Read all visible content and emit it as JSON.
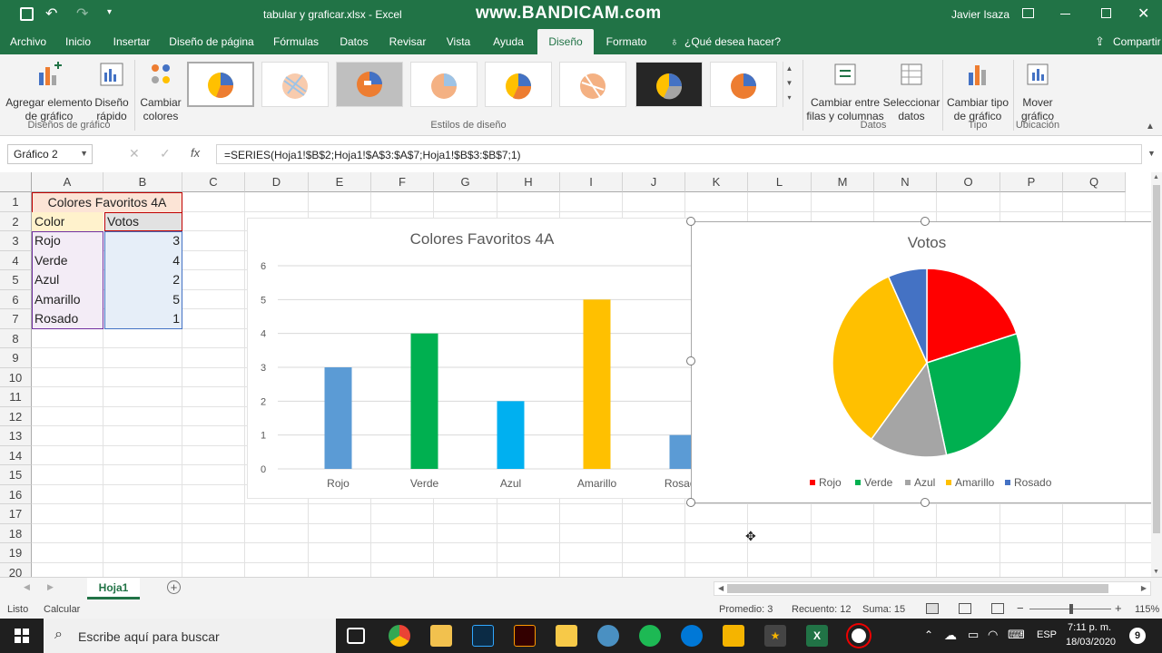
{
  "window": {
    "file_title": "tabular y graficar.xlsx  -  Excel",
    "watermark": "www.BANDICAM.com",
    "user": "Javier Isaza"
  },
  "tabs": [
    "Archivo",
    "Inicio",
    "Insertar",
    "Diseño de página",
    "Fórmulas",
    "Datos",
    "Revisar",
    "Vista",
    "Ayuda",
    "Diseño",
    "Formato"
  ],
  "tell_me": "¿Qué desea hacer?",
  "share": "Compartir",
  "ribbon": {
    "add_element": [
      "Agregar elemento",
      "de gráfico"
    ],
    "quick_layout": [
      "Diseño",
      "rápido"
    ],
    "change_colors": [
      "Cambiar",
      "colores"
    ],
    "group_chart_layouts": "Diseños de gráfico",
    "group_styles": "Estilos de diseño",
    "switch_rowcol": [
      "Cambiar entre",
      "filas y columnas"
    ],
    "select_data": [
      "Seleccionar",
      "datos"
    ],
    "group_data": "Datos",
    "change_type": [
      "Cambiar tipo",
      "de gráfico"
    ],
    "group_type": "Tipo",
    "move_chart": [
      "Mover",
      "gráfico"
    ],
    "group_location": "Ubicación"
  },
  "formula_bar": {
    "name_box": "Gráfico 2",
    "fx": "fx",
    "formula": "=SERIES(Hoja1!$B$2;Hoja1!$A$3:$A$7;Hoja1!$B$3:$B$7;1)"
  },
  "columns": [
    "A",
    "B",
    "C",
    "D",
    "E",
    "F",
    "G",
    "H",
    "I",
    "J",
    "K",
    "L",
    "M",
    "N",
    "O",
    "P",
    "Q"
  ],
  "rows": [
    "1",
    "2",
    "3",
    "4",
    "5",
    "6",
    "7",
    "8",
    "9",
    "10",
    "11",
    "12",
    "13",
    "14",
    "15",
    "16",
    "17",
    "18",
    "19",
    "20"
  ],
  "table": {
    "title": "Colores Favoritos 4A",
    "header": [
      "Color",
      "Votos"
    ],
    "data": [
      {
        "color": "Rojo",
        "votos": "3"
      },
      {
        "color": "Verde",
        "votos": "4"
      },
      {
        "color": "Azul",
        "votos": "2"
      },
      {
        "color": "Amarillo",
        "votos": "5"
      },
      {
        "color": "Rosado",
        "votos": "1"
      }
    ]
  },
  "chart_data": [
    {
      "type": "bar",
      "title": "Colores Favoritos 4A",
      "categories": [
        "Rojo",
        "Verde",
        "Azul",
        "Amarillo",
        "Rosado"
      ],
      "values": [
        3,
        4,
        2,
        5,
        1
      ],
      "colors": [
        "#5b9bd5",
        "#00b050",
        "#00b0f0",
        "#ffc000",
        "#5b9bd5"
      ],
      "ylim": [
        0,
        6
      ],
      "yticks": [
        "0",
        "1",
        "2",
        "3",
        "4",
        "5",
        "6"
      ],
      "grid": true
    },
    {
      "type": "pie",
      "title": "Votos",
      "categories": [
        "Rojo",
        "Verde",
        "Azul",
        "Amarillo",
        "Rosado"
      ],
      "values": [
        3,
        4,
        2,
        5,
        1
      ],
      "colors": [
        "#ff0000",
        "#00b050",
        "#a5a5a5",
        "#ffc000",
        "#4472c4"
      ],
      "legend": "bottom"
    }
  ],
  "sheet_tabs": [
    "Hoja1"
  ],
  "status": {
    "ready": "Listo",
    "calc": "Calcular",
    "average": "Promedio: 3",
    "count": "Recuento: 12",
    "sum": "Suma: 15",
    "zoom": "115%"
  },
  "taskbar": {
    "search_placeholder": "Escribe aquí para buscar",
    "lang": "ESP",
    "time": "7:11 p. m.",
    "date": "18/03/2020"
  }
}
